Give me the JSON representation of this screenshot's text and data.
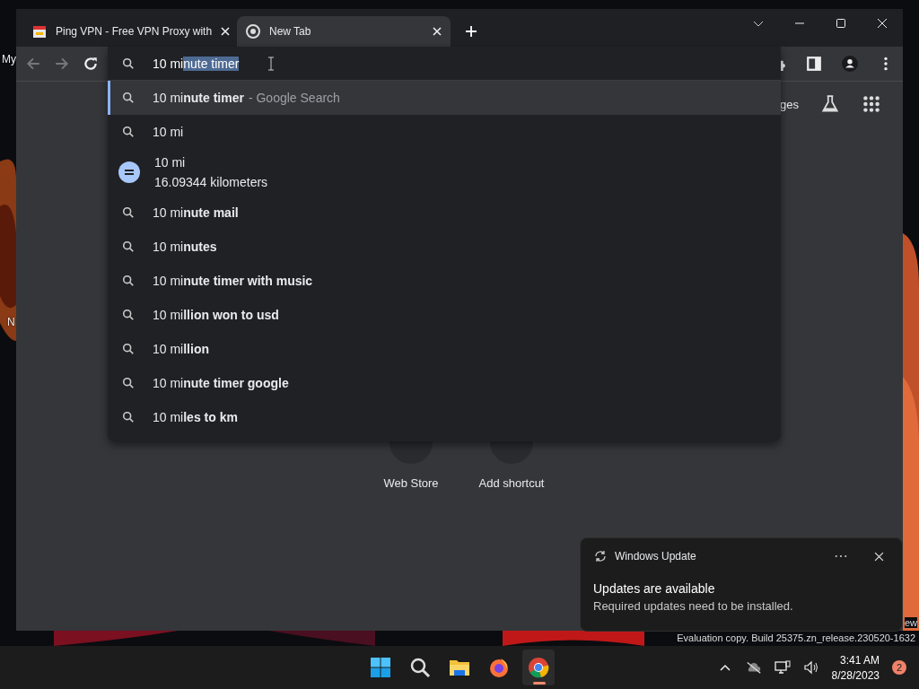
{
  "desktop": {
    "icon_labels": [
      "My",
      "N"
    ],
    "watermark": [
      "ew",
      "Evaluation copy. Build 25375.zn_release.230520-1632"
    ]
  },
  "browser": {
    "tabs": [
      {
        "title": "Ping VPN - Free VPN Proxy with",
        "selected": false
      },
      {
        "title": "New Tab",
        "selected": true
      }
    ],
    "omnibox": {
      "typed": "10 mi",
      "selected_text": "nute timer"
    },
    "suggestions": [
      {
        "kind": "search",
        "text": "10 mi**nute timer**",
        "note": "- Google Search",
        "selected": true
      },
      {
        "kind": "search",
        "text": "10 mi",
        "selected": false
      },
      {
        "kind": "calculator",
        "text": "10 mi",
        "answer": "16.09344 kilometers",
        "selected": false
      },
      {
        "kind": "search",
        "text": "10 mi**nute mail**",
        "selected": false
      },
      {
        "kind": "search",
        "text": "10 mi**nutes**",
        "selected": false
      },
      {
        "kind": "search",
        "text": "10 mi**nute timer with music**",
        "selected": false
      },
      {
        "kind": "search",
        "text": "10 mi**llion won to usd**",
        "selected": false
      },
      {
        "kind": "search",
        "text": "10 mi**llion**",
        "selected": false
      },
      {
        "kind": "search",
        "text": "10 mi**nute timer google**",
        "selected": false
      },
      {
        "kind": "search",
        "text": "10 mi**les to km**",
        "selected": false
      }
    ],
    "header_link": "ges",
    "shortcuts": [
      {
        "label": "Web Store"
      },
      {
        "label": "Add shortcut"
      }
    ]
  },
  "notification": {
    "app": "Windows Update",
    "title": "Updates are available",
    "body": "Required updates need to be installed."
  },
  "taskbar": {
    "apps": [
      {
        "kind": "start",
        "active": false
      },
      {
        "kind": "search",
        "active": false
      },
      {
        "kind": "files",
        "active": false
      },
      {
        "kind": "firefox",
        "active": false
      },
      {
        "kind": "chrome",
        "active": true
      }
    ],
    "time": "3:41 AM",
    "date": "8/28/2023",
    "badge": "2"
  }
}
